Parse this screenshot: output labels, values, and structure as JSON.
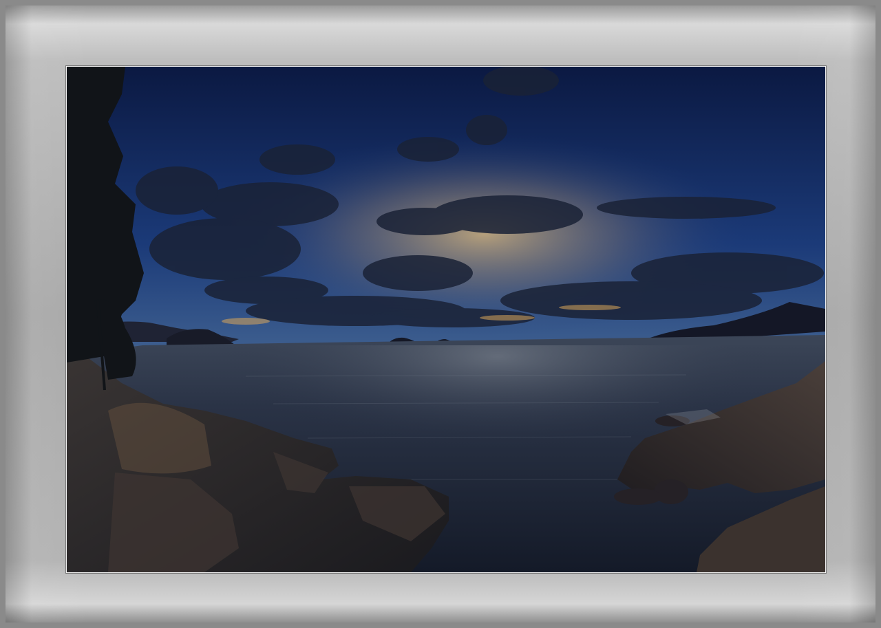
{
  "image": {
    "subject": "seascape-at-dusk",
    "colors": {
      "sky_top": "#0c1a44",
      "sky_mid": "#20407a",
      "horizon_glow": "#e0b46a",
      "sea": "#1d2638",
      "rock": "#2a2a30",
      "mat": "#b0b0b0"
    }
  }
}
